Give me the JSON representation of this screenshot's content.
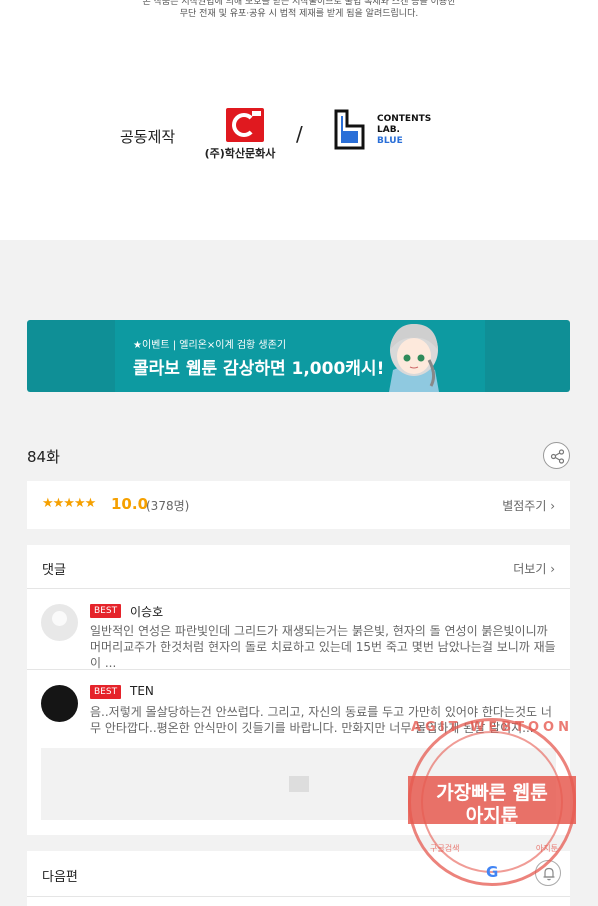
{
  "notice": {
    "line1": "본 작품은 저작권법에 의해 보호를 받는 저작물이므로 불법 복제와 스캔 등을 이용한",
    "line2": "무단 전재 및 유포·공유 시 법적 제재를 받게 됨을 알려드립니다."
  },
  "coproduction": {
    "label": "공동제작",
    "logo1_text": "(주)학산문화사",
    "separator": "/",
    "logo2_line1": "CONTENTS",
    "logo2_line2": "LAB.",
    "logo2_line3": "BLUE"
  },
  "banner": {
    "small_text": "★이벤트 | 엘리온×이계 검황 생존기",
    "big_text": "콜라보 웹툰 감상하면 1,000캐시!"
  },
  "episode": {
    "title": "84화",
    "share_icon": "share-icon"
  },
  "rating": {
    "stars": "★★★★★",
    "score": "10.0",
    "count": "(378명)",
    "rate_link": "별점주기 ›"
  },
  "comments": {
    "header": "댓글",
    "more": "더보기 ›",
    "items": [
      {
        "badge": "BEST",
        "author": "이승호",
        "text": "일반적인 연성은 파란빛인데 그리드가 재생되는거는 붉은빛, 현자의 돌 연성이 붉은빛이니까 머머리교주가 한것처럼 현자의 돌로 치료하고 있는데 15번 죽고 몇번 남았나는걸 보니까 재들이 ..."
      },
      {
        "badge": "BEST",
        "author": "TEN",
        "text": "음..저렇게 몰살당하는건 안쓰럽다. 그리고, 자신의 동료를 두고 가만히 있어야 한다는것도 너무 안타깝다..평온한 안식만이 깃들기를 바랍니다. 만화지만 너무 몰입하게 된달 말이지..."
      }
    ]
  },
  "next": {
    "label": "다음편"
  },
  "watermark": {
    "top_text": "AGIT WEBTOON",
    "line1": "가장빠른 웹툰",
    "line2": "아지툰",
    "bottom_left": "구글검색",
    "bottom_right": "아지툰",
    "g": "G"
  },
  "colors": {
    "accent_rating": "#f5a000",
    "best_badge": "#e5232a",
    "banner_bg": "#0f8f96",
    "watermark": "#e65a50"
  }
}
